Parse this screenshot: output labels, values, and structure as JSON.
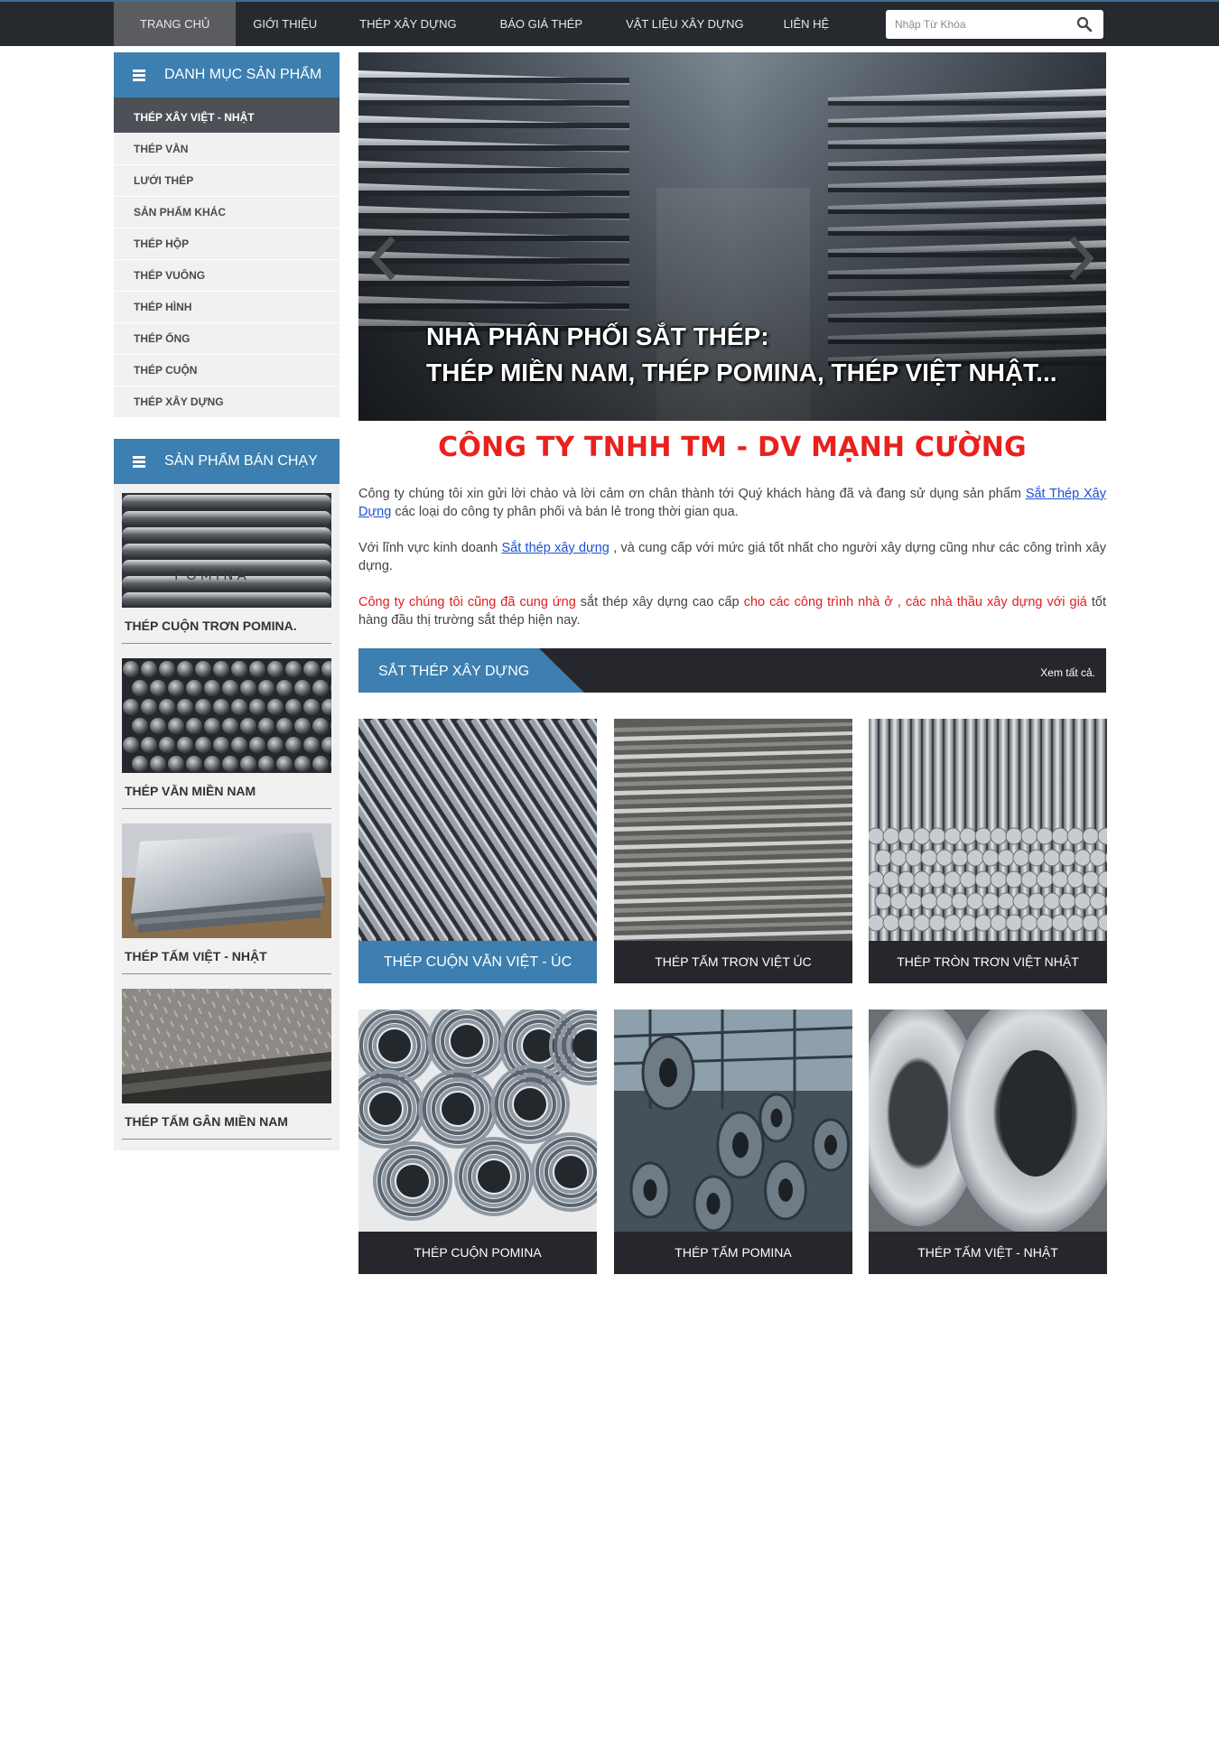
{
  "nav": {
    "items": [
      {
        "label": "TRANG CHỦ",
        "active": true
      },
      {
        "label": "GIỚI THIỆU"
      },
      {
        "label": "THÉP XÂY DỰNG"
      },
      {
        "label": "BÁO GIÁ THÉP"
      },
      {
        "label": "VẬT LIỆU XÂY DỰNG"
      },
      {
        "label": "LIÊN HỆ"
      }
    ],
    "search_placeholder": "Nhập Từ Khóa",
    "search_icon": "search-icon"
  },
  "sidebar": {
    "categories_title": "DANH MỤC SẢN PHẨM",
    "categories": [
      "THÉP XÂY VIỆT - NHẬT",
      "THÉP VẰN",
      "LƯỚI THÉP",
      "SẢN PHẨM KHÁC",
      "THÉP HỘP",
      "THÉP VUÔNG",
      "THÉP HÌNH",
      "THÉP ỐNG",
      "THÉP CUỘN",
      "THÉP XÂY DỰNG"
    ],
    "bestseller_title": "SẢN PHẨM BÁN CHẠY",
    "bestsellers": [
      {
        "name": "THÉP CUỘN TRƠN POMINA.",
        "stamp": "POMINA"
      },
      {
        "name": "THÉP VẰN MIỀN NAM"
      },
      {
        "name": "THÉP TẤM VIỆT - NHẬT"
      },
      {
        "name": "THÉP TẤM GÂN MIỀN NAM"
      }
    ]
  },
  "slider": {
    "caption_line1": "NHÀ PHÂN PHỐI SẮT THÉP:",
    "caption_line2": "THÉP MIỀN NAM, THÉP POMINA, THÉP VIỆT NHẬT..."
  },
  "company": {
    "name": "CÔNG TY TNHH TM - DV MẠNH CƯỜNG",
    "color": "#e9211d"
  },
  "intro": {
    "p1_before": "Công ty chúng tôi xin gửi lời chào và lời cảm ơn chân thành tới Quý khách hàng đã và đang sử dụng sản phẩm ",
    "p1_link": "Sắt Thép Xây Dựng",
    "p1_after": " các loại do công ty  phân phối và bán lẻ trong thời gian qua.",
    "p2_before": "Với lĩnh vực kinh doanh ",
    "p2_link": "Sắt thép xây dựng",
    "p2_after": " , và cung cấp với mức giá tốt nhất cho người xây dựng cũng như các công trình xây dựng.",
    "p3_red1": "Công ty chúng tôi cũng đã cung ứng",
    "p3_mid": " sắt thép xây dựng cao cấp ",
    "p3_red2": "cho các công trình nhà ở , các nhà thầu xây dựng với giá",
    "p3_after": "  tốt hàng đầu thị trường sắt thép hiện nay."
  },
  "section": {
    "title": "SẮT THÉP XÂY DỰNG",
    "see_all": "Xem tất cả."
  },
  "products": [
    {
      "label": "THÉP CUỘN VẰN VIỆT - ÚC",
      "highlight": true
    },
    {
      "label": "THÉP TẤM TRƠN VIỆT ÚC"
    },
    {
      "label": "THÉP TRÒN TRƠN VIỆT NHẬT"
    },
    {
      "label": "THÉP CUỘN POMINA"
    },
    {
      "label": "THÉP TẤM POMINA"
    },
    {
      "label": "THÉP TẤM VIỆT - NHẬT"
    }
  ],
  "colors": {
    "accent": "#3c7fb0",
    "dark": "#25272c",
    "red": "#e21d1d"
  }
}
